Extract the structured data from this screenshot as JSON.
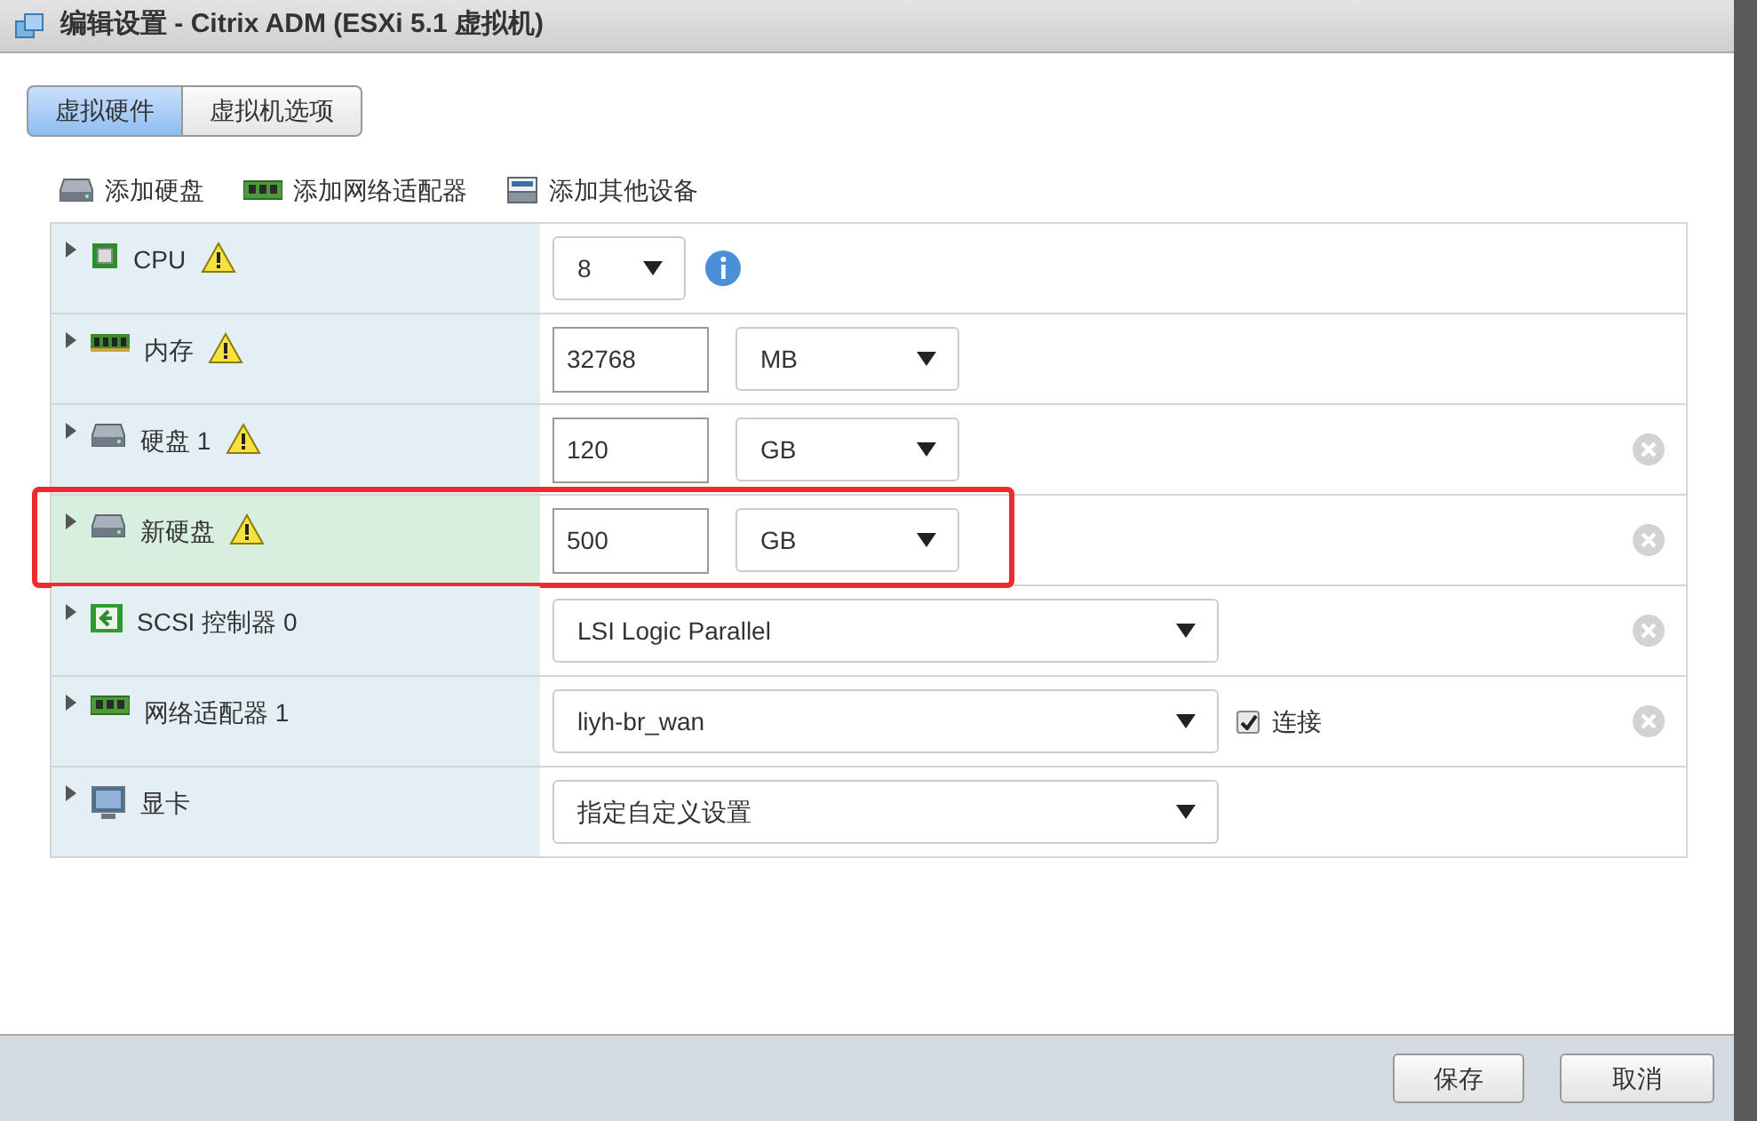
{
  "window": {
    "title": "编辑设置 - Citrix ADM (ESXi 5.1 虚拟机)"
  },
  "tabs": [
    {
      "label": "虚拟硬件",
      "selected": true
    },
    {
      "label": "虚拟机选项",
      "selected": false
    }
  ],
  "toolbar": [
    "添加硬盘",
    "添加网络适配器",
    "添加其他设备"
  ],
  "devices": [
    {
      "kind": "count",
      "label": "CPU",
      "warning": true,
      "value": "8",
      "removable": false,
      "selected": false
    },
    {
      "kind": "size",
      "label": "内存",
      "warning": true,
      "value": "32768",
      "unit": "MB",
      "removable": false,
      "selected": false
    },
    {
      "kind": "size",
      "label": "硬盘 1",
      "warning": true,
      "value": "120",
      "unit": "GB",
      "removable": true,
      "selected": false
    },
    {
      "kind": "size",
      "label": "新硬盘",
      "warning": true,
      "value": "500",
      "unit": "GB",
      "removable": true,
      "selected": true
    },
    {
      "kind": "choice",
      "label": "SCSI 控制器 0",
      "warning": false,
      "value": "LSI Logic Parallel",
      "removable": true,
      "selected": false
    },
    {
      "kind": "choice",
      "label": "网络适配器 1",
      "warning": false,
      "value": "liyh-br_wan",
      "connect": {
        "label": "连接",
        "checked": true
      },
      "removable": true,
      "selected": false
    },
    {
      "kind": "choice",
      "label": "显卡",
      "warning": false,
      "value": "指定自定义设置",
      "removable": false,
      "selected": false
    }
  ],
  "buttons": [
    "保存",
    "取消"
  ]
}
